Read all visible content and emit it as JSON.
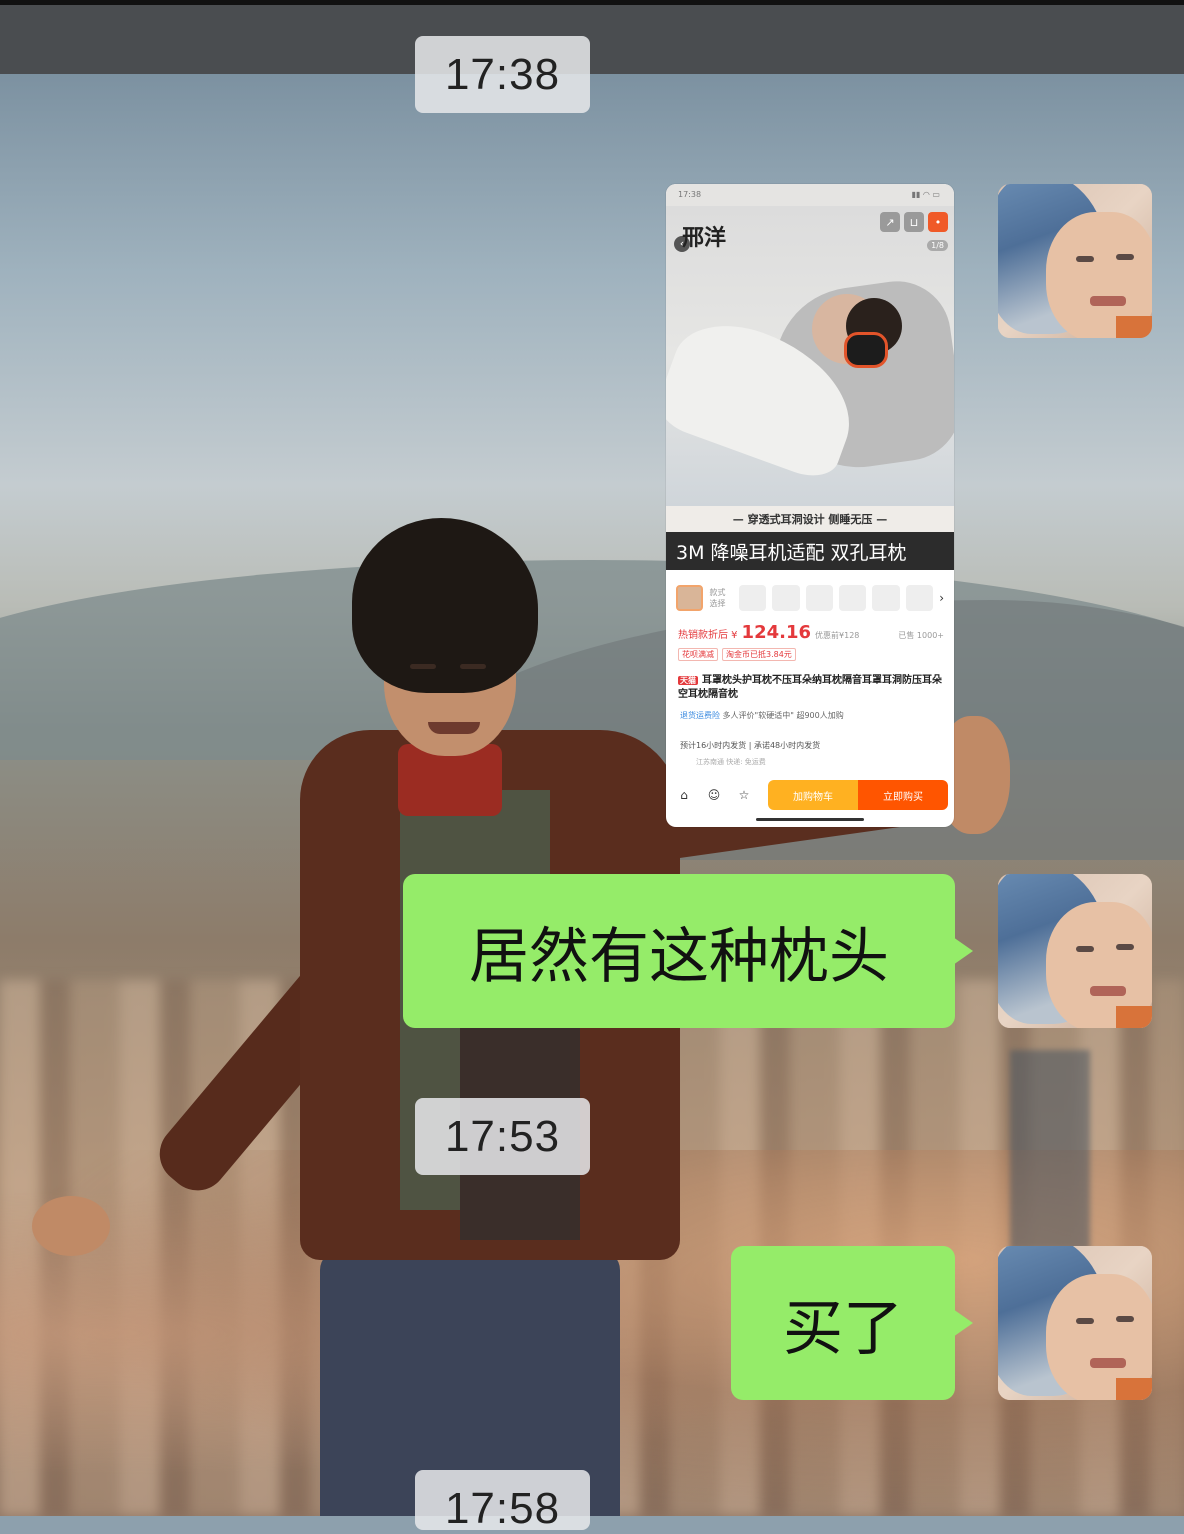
{
  "timestamps": [
    "17:38",
    "17:53",
    "17:58"
  ],
  "messages": [
    {
      "type": "image",
      "sender": "self"
    },
    {
      "type": "text",
      "sender": "self",
      "text": "居然有这种枕头"
    },
    {
      "type": "text",
      "sender": "self",
      "text": "买了"
    }
  ],
  "product_card": {
    "status_time": "17:38",
    "brand": "邢洋",
    "page_indicator": "1/8",
    "tagline": "— 穿透式耳洞设计 侧睡无压 —",
    "banner": "3M 降噪耳机适配 双孔耳枕",
    "style_label": "款式选择",
    "price_prefix": "热销款折后 ¥",
    "price": "124.16",
    "price_original": "优惠前¥128",
    "sold": "已售 1000+",
    "chips": [
      "花呗满减",
      "淘金币已抵3.84元"
    ],
    "tmall_tag": "天猫",
    "title": "耳罩枕头护耳枕不压耳朵纳耳枕隔音耳罩耳洞防压耳朵空耳枕隔音枕",
    "meta_guarantee": "退货运费险",
    "meta_review": "多人评价\"软硬适中\"  超900人加购",
    "shipping": "预计16小时内发货 | 承诺48小时内发货",
    "shipping_sub": "江苏南通  快递: 免运费",
    "bottom_icons": [
      "店铺",
      "客服",
      "收藏"
    ],
    "add_to_cart": "加购物车",
    "buy_now": "立即购买"
  },
  "colors": {
    "bubble_green": "#95ec69",
    "topbar": "#4a4d50",
    "timestamp_bg": "#e6e8ea"
  }
}
